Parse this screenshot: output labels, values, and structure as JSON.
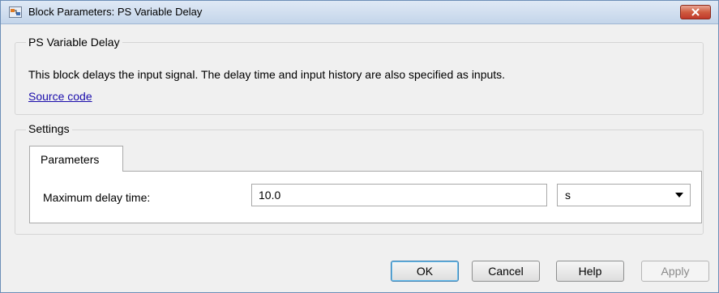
{
  "window": {
    "title": "Block Parameters: PS Variable Delay",
    "close_icon": "close-icon"
  },
  "block": {
    "group_title": "PS Variable Delay",
    "description": "This block delays the input signal. The delay time and input history are also specified as inputs.",
    "source_link": "Source code"
  },
  "settings": {
    "group_title": "Settings",
    "tabs": [
      {
        "label": "Parameters",
        "selected": true
      }
    ],
    "parameters": {
      "max_delay_label": "Maximum delay time:",
      "max_delay_value": "10.0",
      "max_delay_unit": "s"
    }
  },
  "buttons": {
    "ok": "OK",
    "cancel": "Cancel",
    "help": "Help",
    "apply": "Apply"
  },
  "colors": {
    "link": "#1a0dab",
    "close_button": "#c0392b",
    "titlebar": "#c4d5ea"
  }
}
